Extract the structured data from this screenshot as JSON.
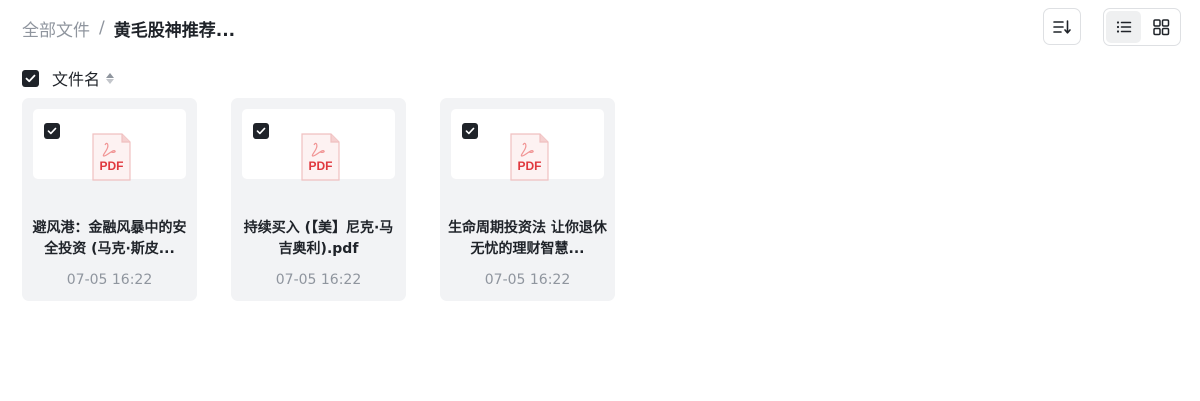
{
  "breadcrumb": {
    "root": "全部文件",
    "separator": "/",
    "current": "黄毛股神推荐..."
  },
  "toolbar": {
    "sort_icon": "sort-list-icon",
    "list_view_icon": "list-view-icon",
    "grid_view_icon": "grid-view-icon",
    "active_view": "list"
  },
  "list_header": {
    "select_all_checked": true,
    "column_label": "文件名"
  },
  "files": [
    {
      "name": "避风港：金融风暴中的安全投资 (马克·斯皮...",
      "time": "07-05 16:22",
      "type": "PDF",
      "checked": true
    },
    {
      "name": "持续买入 (【美】尼克·马吉奥利).pdf",
      "time": "07-05 16:22",
      "type": "PDF",
      "checked": true
    },
    {
      "name": "生命周期投资法 让你退休无忧的理财智慧...",
      "time": "07-05 16:22",
      "type": "PDF",
      "checked": true
    }
  ],
  "colors": {
    "accent_dark": "#1f2329",
    "muted": "#8f959e",
    "card_bg": "#f2f3f5",
    "pdf_red": "#e0383e"
  }
}
